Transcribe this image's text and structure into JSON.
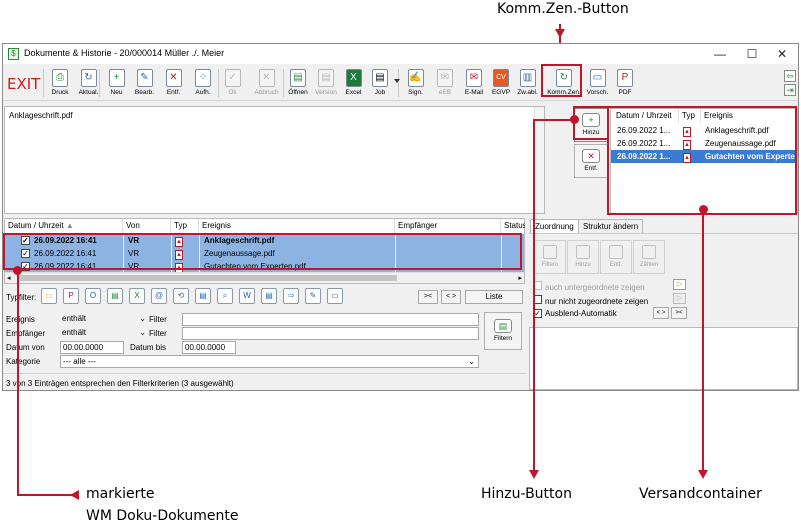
{
  "annotations": {
    "komm_zen_button": "Komm.Zen.-Button",
    "markierte_line1": "markierte",
    "markierte_line2": "WM Doku-Dokumente",
    "hinzu_button": "Hinzu-Button",
    "versandcontainer": "Versandcontainer"
  },
  "window": {
    "title": "Dokumente & Historie - 20/000014  Müller ./. Meier",
    "minimize": "—",
    "maximize": "☐",
    "close": "✕"
  },
  "toolbar": {
    "exit": "EXIT",
    "buttons": [
      {
        "label": "Druck",
        "icon": "print-icon",
        "glyph": "⎙"
      },
      {
        "label": "Aktual.",
        "icon": "refresh-icon",
        "glyph": "↻"
      },
      {
        "label": "Neu",
        "icon": "new-icon",
        "glyph": "+"
      },
      {
        "label": "Bearb.",
        "icon": "edit-icon",
        "glyph": "✎"
      },
      {
        "label": "Entf.",
        "icon": "delete-icon",
        "glyph": "✕"
      },
      {
        "label": "Aufh.",
        "icon": "dissolve-icon",
        "glyph": "⁘"
      },
      {
        "label": "Ok",
        "icon": "ok-icon",
        "glyph": "✓"
      },
      {
        "label": "Abbruch",
        "icon": "cancel-icon",
        "glyph": "✕"
      },
      {
        "label": "Öffnen",
        "icon": "open-icon",
        "glyph": "▤"
      },
      {
        "label": "Version",
        "icon": "version-icon",
        "glyph": "▤"
      },
      {
        "label": "Excel",
        "icon": "excel-icon",
        "glyph": "X"
      },
      {
        "label": "Job",
        "icon": "job-icon",
        "glyph": "▤"
      },
      {
        "label": "Sign.",
        "icon": "sign-icon",
        "glyph": "✍"
      },
      {
        "label": "eEB",
        "icon": "eeb-icon",
        "glyph": "✉"
      },
      {
        "label": "E-Mail",
        "icon": "email-icon",
        "glyph": "✉"
      },
      {
        "label": "EGVP",
        "icon": "egvp-icon",
        "glyph": "CV"
      },
      {
        "label": "Zw.abl.",
        "icon": "clipboard-icon",
        "glyph": "▥"
      },
      {
        "label": "Komm.Zen.",
        "icon": "komm-zen-icon",
        "glyph": "↻"
      },
      {
        "label": "Vorsch.",
        "icon": "preview-icon",
        "glyph": "▭"
      },
      {
        "label": "PDF",
        "icon": "pdf-icon",
        "glyph": "P"
      }
    ]
  },
  "preview": {
    "filename": "Anklageschrift.pdf"
  },
  "side_buttons": {
    "add": "Hinzu",
    "remove": "Entf."
  },
  "container": {
    "headers": [
      "Datum / Uhrzeit",
      "Typ",
      "Ereignis"
    ],
    "rows": [
      {
        "date": "26.09.2022  1...",
        "event": "Anklageschrift.pdf",
        "selected": false
      },
      {
        "date": "26.09.2022  1...",
        "event": "Zeugenaussage.pdf",
        "selected": false
      },
      {
        "date": "26.09.2022  1...",
        "event": "Gutachten vom Experte",
        "selected": true
      }
    ]
  },
  "doc_table": {
    "headers": [
      "Datum / Uhrzeit",
      "Von",
      "Typ",
      "Ereignis",
      "Empfänger",
      "Status"
    ],
    "rows": [
      {
        "date": "26.09.2022  16:41",
        "from": "VR",
        "event": "Anklageschrift.pdf",
        "bold": true
      },
      {
        "date": "26.09.2022  16:41",
        "from": "VR",
        "event": "Zeugenaussage.pdf",
        "bold": false
      },
      {
        "date": "26.09.2022  16:41",
        "from": "VR",
        "event": "Gutachten vom Experten.pdf",
        "bold": false
      }
    ]
  },
  "typfilter": {
    "label": "Typfilter:",
    "icons": [
      "folder-icon",
      "pdf-icon",
      "outlook-icon",
      "document-icon",
      "excel-icon",
      "email-at-icon",
      "link-icon",
      "note-icon",
      "search-doc-icon",
      "word-icon",
      "document-icon",
      "tag-icon",
      "pen-icon",
      "folder-open-icon"
    ],
    "collapse": "><",
    "expand": "< >",
    "list_button": "Liste"
  },
  "filter": {
    "ereignis_label": "Ereignis",
    "ereignis_value": "enthält",
    "ereignis_filter_label": "Filter",
    "empfaenger_label": "Empfänger",
    "empfaenger_value": "enthält",
    "empfaenger_filter_label": "Filter",
    "datum_von_label": "Datum von",
    "datum_von_value": "00.00.0000",
    "datum_bis_label": "Datum bis",
    "datum_bis_value": "00.00.0000",
    "kategorie_label": "Kategorie",
    "kategorie_value": "--- alle ---",
    "filter_button": "Filtern"
  },
  "status_text": "3 von 3 Einträgen entsprechen den Filterkriterien (3 ausgewählt)",
  "tabs": {
    "zuordnung": "Zuordnung",
    "struktur": "Struktur ändern"
  },
  "zuordnung": {
    "buttons": [
      "Filtern",
      "Hinzu",
      "Entf.",
      "Zählen"
    ],
    "opt1": "auch untergeordnete zeigen",
    "opt2": "nur nicht zugeordnete zeigen",
    "opt3": "Ausblend-Automatik",
    "btn_expand": "< >",
    "btn_collapse": "><"
  },
  "colors": {
    "accent_red": "#c0162c",
    "selection": "#8db3e2",
    "selection_dark": "#3a7bd5"
  }
}
